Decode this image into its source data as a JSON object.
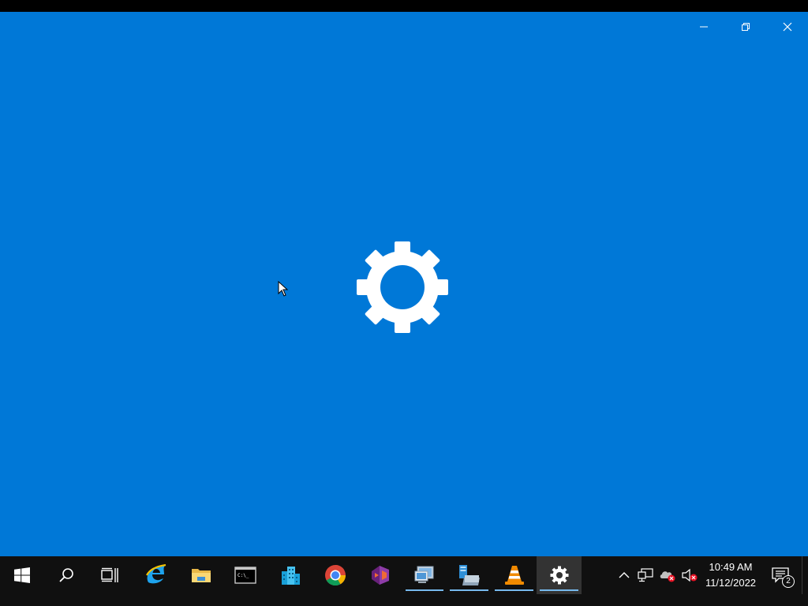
{
  "window": {
    "background_color": "#0078d7",
    "controls": {
      "minimize_icon": "minimize-icon",
      "restore_icon": "restore-icon",
      "close_icon": "close-icon"
    },
    "splash_icon": "gear-icon"
  },
  "taskbar": {
    "background_color": "#101010",
    "pinned": [
      {
        "name": "start-button",
        "icon": "windows-logo-icon"
      },
      {
        "name": "search-button",
        "icon": "search-icon"
      },
      {
        "name": "task-view-button",
        "icon": "task-view-icon"
      },
      {
        "name": "internet-explorer",
        "icon": "internet-explorer-icon"
      },
      {
        "name": "file-explorer",
        "icon": "folder-icon"
      },
      {
        "name": "command-prompt",
        "icon": "terminal-icon"
      },
      {
        "name": "server-manager",
        "icon": "buildings-icon"
      },
      {
        "name": "google-chrome",
        "icon": "chrome-icon"
      },
      {
        "name": "visual-studio",
        "icon": "visual-studio-icon"
      },
      {
        "name": "remote-desktop",
        "icon": "remote-desktop-icon"
      },
      {
        "name": "network-app",
        "icon": "network-computer-icon"
      },
      {
        "name": "vlc-player",
        "icon": "vlc-cone-icon"
      },
      {
        "name": "settings",
        "icon": "gear-icon"
      }
    ],
    "tray": {
      "chevron_icon": "chevron-up-icon",
      "network_icon": "network-icon",
      "onedrive_icon": "cloud-error-icon",
      "volume_icon": "volume-muted-icon",
      "time": "10:49 AM",
      "date": "11/12/2022",
      "notification_icon": "notification-icon",
      "notification_count": "2"
    }
  }
}
